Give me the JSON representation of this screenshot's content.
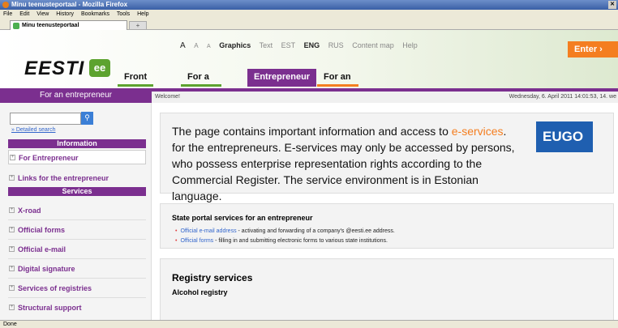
{
  "window": {
    "title": "Minu teenusteportaal - Mozilla Firefox"
  },
  "menubar": {
    "items": [
      "File",
      "Edit",
      "View",
      "History",
      "Bookmarks",
      "Tools",
      "Help"
    ]
  },
  "tab": {
    "label": "Minu teenusteportaal"
  },
  "header": {
    "logo": "EESTI",
    "logo_mark": "ee",
    "font_sizes": [
      "A",
      "A",
      "A"
    ],
    "view_options": [
      "Graphics",
      "Text"
    ],
    "languages": [
      "EST",
      "ENG",
      "RUS"
    ],
    "links": [
      "Content map",
      "Help"
    ],
    "enter_label": "Enter ›"
  },
  "mainnav": {
    "front": "Front page",
    "citizen": "For a citizen",
    "entrepreneur": "Entrepreneur",
    "official": "For an official"
  },
  "sidebar": {
    "heading": "For an entrepreneur",
    "detailed_search": "» Detailed search",
    "section_information": "Information",
    "for_entrepreneur": "For Entrepreneur",
    "links": "Links for the entrepreneur",
    "section_services": "Services",
    "items": [
      "X-road",
      "Official forms",
      "Official e-mail",
      "Digital signature",
      "Services of registries",
      "Structural support"
    ]
  },
  "welcome": {
    "text": "Welcome!",
    "date": "Wednesday, 6. April 2011 14:01:53, 14. we"
  },
  "content": {
    "intro_before": "The page contains important information and access to ",
    "intro_link": "e-services",
    "intro_after": ". for the entrepreneurs. E-services may only be accessed by persons, who possess enterprise representation rights according to the Commercial Register. The service environment is in Estonian language.",
    "eugo": "EUGO",
    "state_heading": "State portal services for an entrepreneur",
    "state_items": [
      {
        "link": "Official e-mail address",
        "text": " - activating and forwarding of a company's @eesti.ee address."
      },
      {
        "link": "Official forms",
        "text": " - filling in and submitting electronic forms to various state institutions."
      }
    ],
    "registry_heading": "Registry services",
    "registry_sub": "Alcohol registry"
  },
  "statusbar": {
    "text": "Done"
  }
}
